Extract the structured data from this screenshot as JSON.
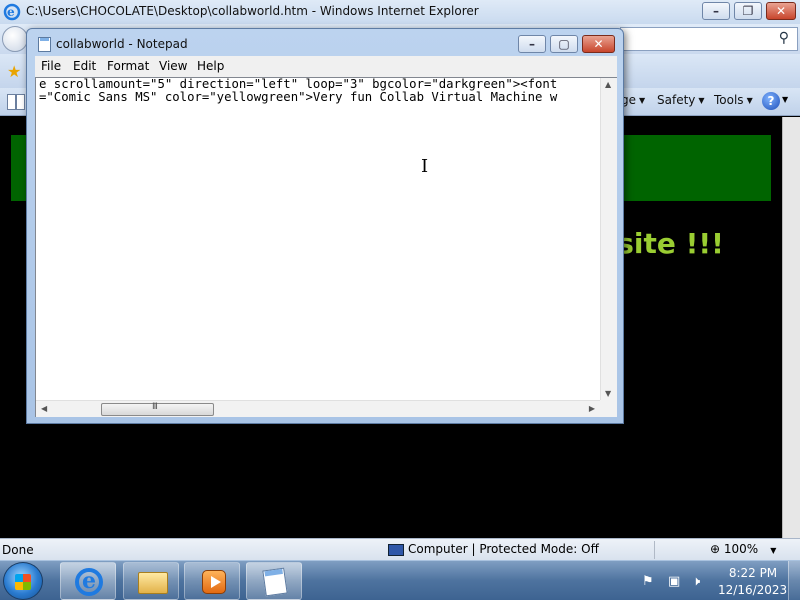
{
  "ie": {
    "title": "C:\\Users\\CHOCOLATE\\Desktop\\collabworld.htm - Windows Internet Explorer",
    "command_bar": {
      "page": "ge",
      "safety": "Safety",
      "tools": "Tools",
      "help": "?"
    },
    "page": {
      "welcome_fragment": "osite !!!"
    },
    "status": {
      "text": "Done",
      "zone": "Computer | Protected Mode: Off",
      "zoom": "100%"
    }
  },
  "notepad": {
    "title": "collabworld - Notepad",
    "menu": [
      "File",
      "Edit",
      "Format",
      "View",
      "Help"
    ],
    "content_lines": [
      "e scrollamount=\"5\" direction=\"left\" loop=\"3\" bgcolor=\"darkgreen\"><font",
      "=\"Comic Sans MS\" color=\"yellowgreen\">Very fun Collab Virtual Machine w"
    ],
    "hscroll_grip": "III"
  },
  "taskbar": {
    "time": "8:22 PM",
    "date": "12/16/2023"
  },
  "colors": {
    "marquee_bg": "#006400",
    "welcome_text": "#9acd32",
    "page_bg": "#000000"
  }
}
